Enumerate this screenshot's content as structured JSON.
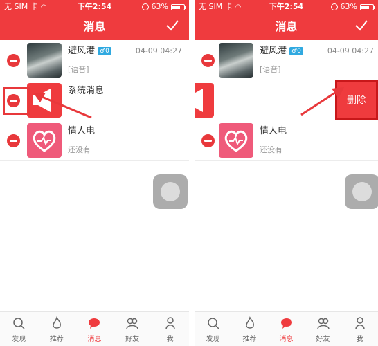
{
  "colors": {
    "accent": "#ef3b3e",
    "badge": "#30a9e0",
    "heart_bg": "#ef5a7a"
  },
  "status_bar": {
    "carrier": "无 SIM 卡",
    "time": "下午2:54",
    "battery_pct": "63%",
    "battery_level": 0.63
  },
  "header": {
    "title": "消息"
  },
  "messages": [
    {
      "name": "避风港",
      "badge": "♂0",
      "time": "04-09 04:27",
      "preview": "[语音]",
      "avatar_icon": "wolf-avatar"
    },
    {
      "name": "系统消息",
      "avatar_icon": "megaphone-icon"
    },
    {
      "name": "情人电",
      "preview": "还没有",
      "avatar_icon": "heart-icon"
    }
  ],
  "right_panel": {
    "delete_label": "删除"
  },
  "tabs": [
    {
      "label": "发现",
      "icon": "search-icon"
    },
    {
      "label": "推荐",
      "icon": "flame-icon"
    },
    {
      "label": "消息",
      "icon": "message-icon",
      "active": true
    },
    {
      "label": "好友",
      "icon": "friends-icon"
    },
    {
      "label": "我",
      "icon": "person-icon"
    }
  ]
}
